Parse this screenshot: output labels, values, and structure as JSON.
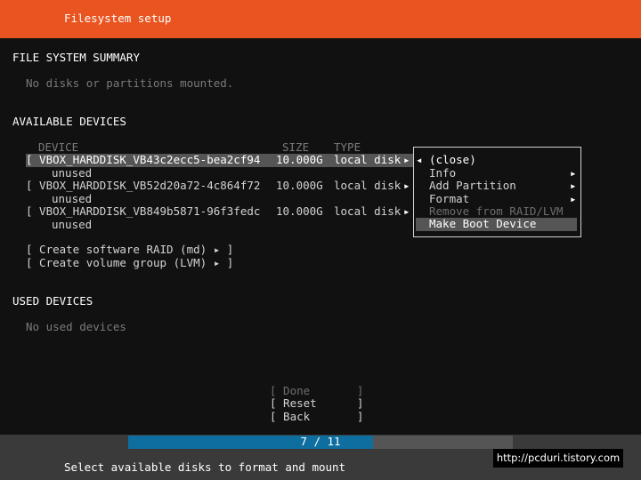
{
  "header": {
    "title": "Filesystem setup"
  },
  "summary": {
    "heading": "FILE SYSTEM SUMMARY",
    "empty": "No disks or partitions mounted."
  },
  "available": {
    "heading": "AVAILABLE DEVICES",
    "columns": {
      "device": "DEVICE",
      "size": "SIZE",
      "type": "TYPE"
    },
    "devices": [
      {
        "name": "[ VBOX_HARDDISK_VB43c2ecc5-bea2cf94",
        "size": "10.000G",
        "type": "local disk",
        "arrow": "▸",
        "sub": "unused"
      },
      {
        "name": "[ VBOX_HARDDISK_VB52d20a72-4c864f72",
        "size": "10.000G",
        "type": "local disk",
        "arrow": "▸",
        "sub": "unused"
      },
      {
        "name": "[ VBOX_HARDDISK_VB849b5871-96f3fedc",
        "size": "10.000G",
        "type": "local disk",
        "arrow": "▸",
        "sub": "unused"
      }
    ],
    "actions": [
      "[ Create software RAID (md) ▸ ]",
      "[ Create volume group (LVM) ▸ ]"
    ]
  },
  "context_menu": {
    "items": [
      {
        "label": "◂ (close)",
        "arrow": ""
      },
      {
        "label": "Info",
        "arrow": "▸"
      },
      {
        "label": "Add Partition",
        "arrow": "▸"
      },
      {
        "label": "Format",
        "arrow": "▸"
      },
      {
        "label": "Remove from RAID/LVM",
        "arrow": ""
      },
      {
        "label": "Make Boot Device",
        "arrow": ""
      }
    ],
    "selected_index": 5
  },
  "used": {
    "heading": "USED DEVICES",
    "empty": "No used devices"
  },
  "buttons": {
    "done": "[ Done       ]",
    "reset": "[ Reset      ]",
    "back": "[ Back       ]"
  },
  "footer": {
    "progress_text": "7 / 11",
    "progress_fraction": 0.6364,
    "help": "Select available disks to format and mount"
  },
  "watermark": "http://pcduri.tistory.com",
  "colors": {
    "accent": "#E95420",
    "progress": "#0E6E9F",
    "highlight": "#555555"
  }
}
